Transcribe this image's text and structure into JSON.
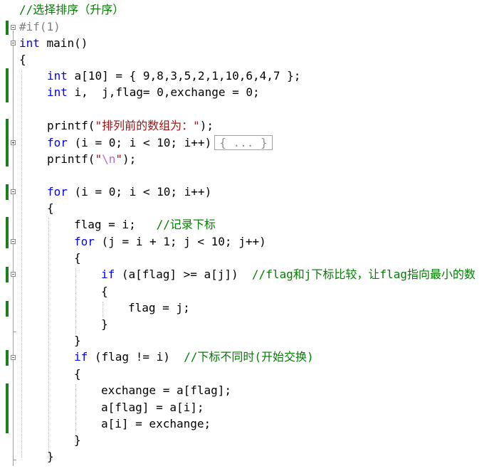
{
  "lines": [
    [
      {
        "c": "cm",
        "t": "//选择排序（升序）"
      }
    ],
    [
      {
        "c": "pp",
        "t": "#if(1)"
      }
    ],
    [
      {
        "c": "kw",
        "t": "int"
      },
      {
        "c": "tx",
        "t": " main()"
      }
    ],
    [
      {
        "c": "tx",
        "t": "{"
      }
    ],
    [
      {
        "c": "kw",
        "t": "int"
      },
      {
        "c": "tx",
        "t": " a[10] = { 9,8,3,5,2,1,10,6,4,7 };"
      }
    ],
    [
      {
        "c": "kw",
        "t": "int"
      },
      {
        "c": "tx",
        "t": " i,  j,flag= 0,exchange = 0;"
      }
    ],
    [
      {
        "c": "tx",
        "t": "printf("
      },
      {
        "c": "st",
        "t": "\"排列前的数组为：\""
      },
      {
        "c": "tx",
        "t": ");"
      }
    ],
    [
      {
        "c": "kw",
        "t": "for"
      },
      {
        "c": "tx",
        "t": " (i = 0; i < 10; i++)"
      }
    ],
    [
      {
        "c": "tx",
        "t": "printf("
      },
      {
        "c": "st",
        "t": "\""
      },
      {
        "c": "esc",
        "t": "\\n"
      },
      {
        "c": "st",
        "t": "\""
      },
      {
        "c": "tx",
        "t": ");"
      }
    ],
    [
      {
        "c": "kw",
        "t": "for"
      },
      {
        "c": "tx",
        "t": " (i = 0; i < 10; i++)"
      }
    ],
    [
      {
        "c": "tx",
        "t": "{"
      }
    ],
    [
      {
        "c": "tx",
        "t": "flag = i;   "
      },
      {
        "c": "cm",
        "t": "//记录下标"
      }
    ],
    [
      {
        "c": "kw",
        "t": "for"
      },
      {
        "c": "tx",
        "t": " (j = i + 1; j < 10; j++)"
      }
    ],
    [
      {
        "c": "tx",
        "t": "{"
      }
    ],
    [
      {
        "c": "kw",
        "t": "if"
      },
      {
        "c": "tx",
        "t": " (a[flag] >= a[j])  "
      },
      {
        "c": "cm",
        "t": "//flag和j下标比较，让flag指向最小的数"
      }
    ],
    [
      {
        "c": "tx",
        "t": "{"
      }
    ],
    [
      {
        "c": "tx",
        "t": "flag = j;"
      }
    ],
    [
      {
        "c": "tx",
        "t": "}"
      }
    ],
    [
      {
        "c": "tx",
        "t": "}"
      }
    ],
    [
      {
        "c": "kw",
        "t": "if"
      },
      {
        "c": "tx",
        "t": " (flag != i)  "
      },
      {
        "c": "cm",
        "t": "//下标不同时(开始交换)"
      }
    ],
    [
      {
        "c": "tx",
        "t": "{"
      }
    ],
    [
      {
        "c": "tx",
        "t": "exchange = a[flag];"
      }
    ],
    [
      {
        "c": "tx",
        "t": "a[flag] = a[i];"
      }
    ],
    [
      {
        "c": "tx",
        "t": "a[i] = exchange;"
      }
    ],
    [
      {
        "c": "tx",
        "t": "}"
      }
    ],
    [
      {
        "c": "tx",
        "t": "}"
      }
    ]
  ],
  "collapsed_block": "{ ... }"
}
